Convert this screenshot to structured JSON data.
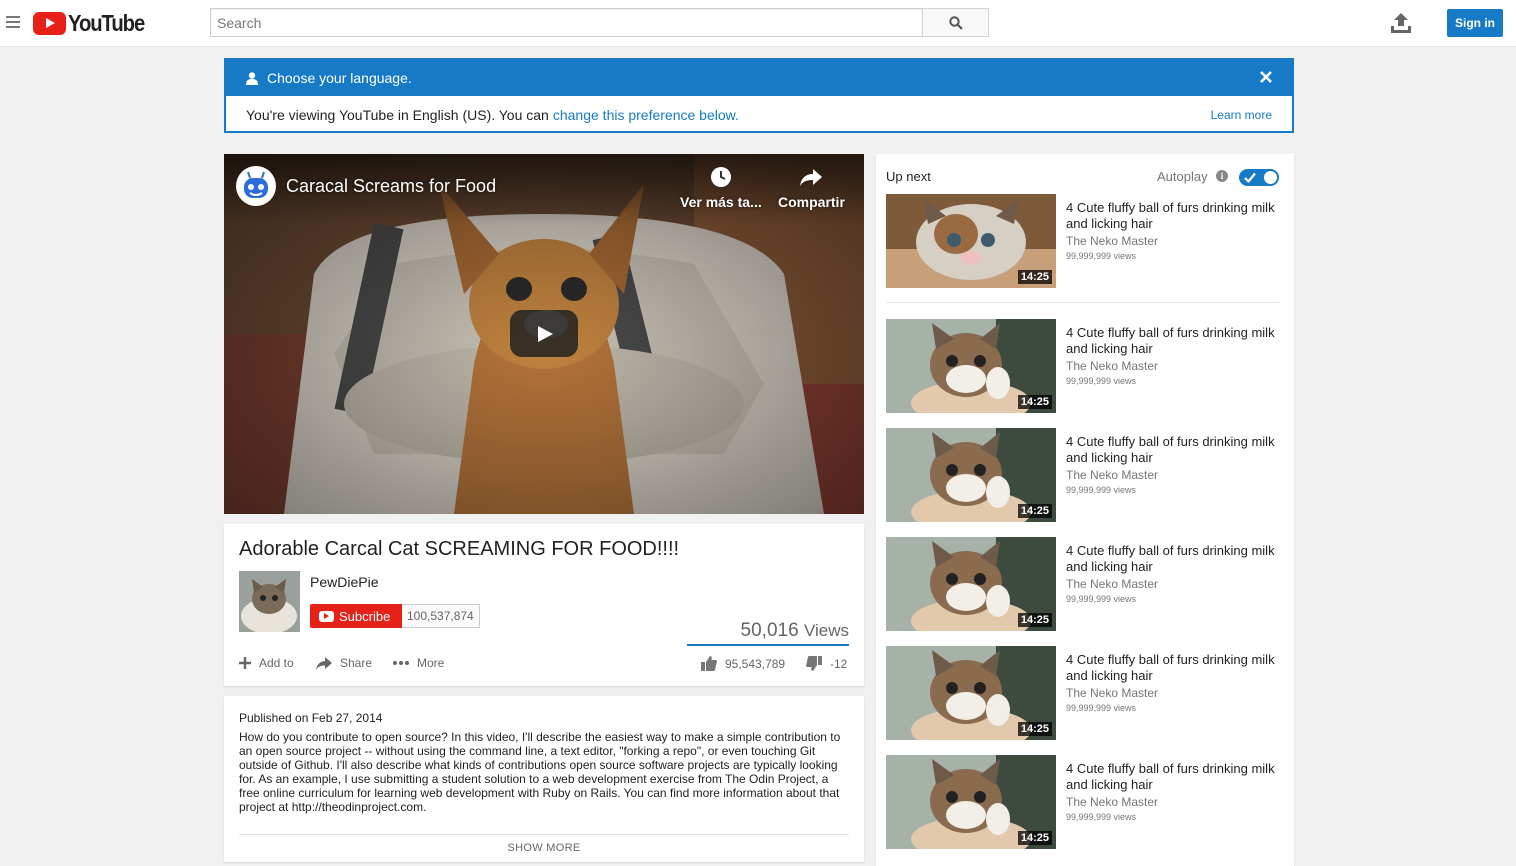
{
  "header": {
    "logo_text": "YouTube",
    "search_placeholder": "Search",
    "signin_label": "Sign in"
  },
  "language_notice": {
    "title": "Choose your language.",
    "body_prefix": "You're viewing YouTube in English (US). You can",
    "body_link": "change this preference below.",
    "learn_more": "Learn more"
  },
  "player": {
    "overlay_title": "Caracal Screams for Food",
    "watch_later_label": "Ver más ta...",
    "share_label": "Compartir"
  },
  "video": {
    "title": "Adorable Carcal Cat SCREAMING FOR FOOD!!!!",
    "owner": "PewDiePie",
    "subscribe_label": "Subcribe",
    "subscriber_count": "100,537,874",
    "views_number": "50,016",
    "views_unit": "Views",
    "add_to_label": "Add to",
    "share_label": "Share",
    "more_label": "More",
    "likes": "95,543,789",
    "dislikes": "-12",
    "like_ratio": 1.0
  },
  "description": {
    "published": "Published on Feb 27, 2014",
    "text": "How do you contribute to open source? In this video, I'll describe the easiest way to make a simple contribution to an open source project -- without using the command line, a text editor, \"forking a repo\", or even touching Git outside of Github. I'll also describe what kinds of contributions open source software projects are typically looking for. As an example, I use submitting a student solution to a web development exercise from The Odin Project, a free online curriculum for learning web development with Ruby on Rails. You can find more information about that project at http://theodinproject.com.",
    "show_more": "SHOW MORE"
  },
  "sidebar": {
    "up_next": "Up next",
    "autoplay": "Autoplay",
    "autoplay_on": true,
    "items": [
      {
        "title": "4 Cute fluffy ball of furs drinking milk and licking hair",
        "channel": "The Neko Master",
        "views": "99,999,999 views",
        "duration": "14:25"
      },
      {
        "title": "4 Cute fluffy ball of furs drinking milk and licking hair",
        "channel": "The Neko Master",
        "views": "99,999,999 views",
        "duration": "14:25"
      },
      {
        "title": "4 Cute fluffy ball of furs drinking milk and licking hair",
        "channel": "The Neko Master",
        "views": "99,999,999 views",
        "duration": "14:25"
      },
      {
        "title": "4 Cute fluffy ball of furs drinking milk and licking hair",
        "channel": "The Neko Master",
        "views": "99,999,999 views",
        "duration": "14:25"
      },
      {
        "title": "4 Cute fluffy ball of furs drinking milk and licking hair",
        "channel": "The Neko Master",
        "views": "99,999,999 views",
        "duration": "14:25"
      },
      {
        "title": "4 Cute fluffy ball of furs drinking milk and licking hair",
        "channel": "The Neko Master",
        "views": "99,999,999 views",
        "duration": "14:25"
      }
    ]
  },
  "colors": {
    "brand_red": "#e62117",
    "accent_blue": "#167ac6"
  }
}
